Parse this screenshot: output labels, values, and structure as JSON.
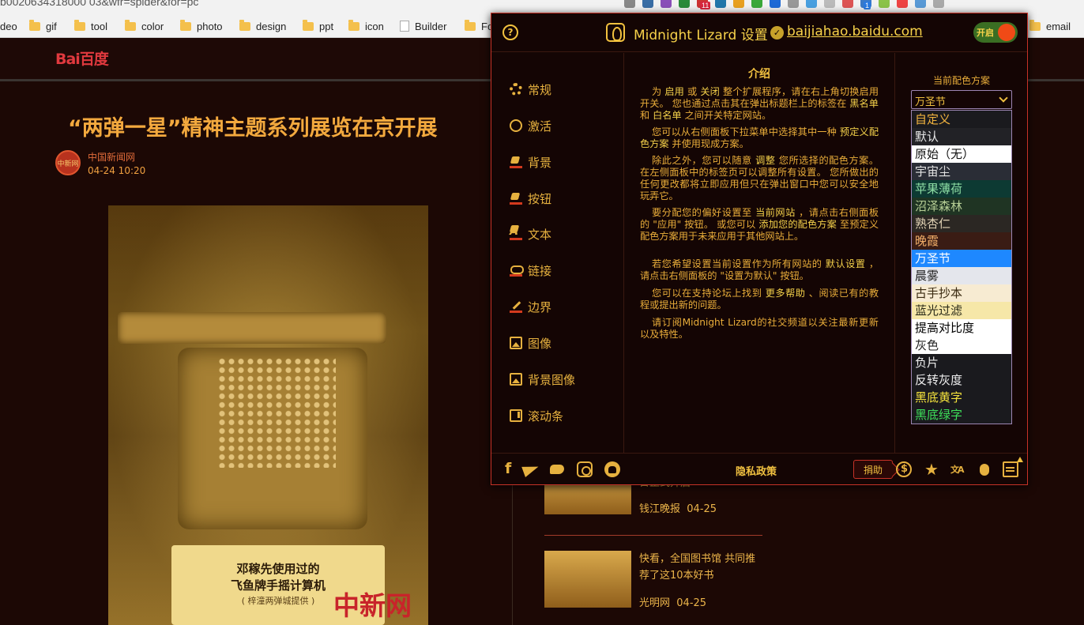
{
  "browser": {
    "url_fragment": "b0020634318000 03&wfr=spider&for=pc",
    "bookmarks": [
      "deo",
      "gif",
      "tool",
      "color",
      "photo",
      "design",
      "ppt",
      "icon",
      "Builder",
      "Fo",
      "email"
    ],
    "extension_badges": [
      "11",
      "1"
    ]
  },
  "page": {
    "logo_text": "Bai百度",
    "title": "“两弹一星”精神主题系列展览在京开展",
    "author_avatar": "中新网",
    "author": "中国新闻网",
    "time": "04-24   10:20",
    "placard_line1": "邓稼先使用过的",
    "placard_line2": "飞鱼牌手摇计算机",
    "placard_line3": "( 梓潼两弹城提供 )",
    "watermark": "中新网",
    "news": [
      {
        "title": "日正式开启",
        "source": "钱江晚报",
        "date": "04-25"
      },
      {
        "title": "快看，全国图书馆 共同推荐了这10本好书",
        "source": "光明网",
        "date": "04-25"
      }
    ]
  },
  "popup": {
    "header": {
      "app_name": "Midnight Lizard 设置",
      "site": "baijiahao.baidu.com",
      "toggle_label": "开启",
      "help_symbol": "?",
      "check_symbol": "✓"
    },
    "sidebar": [
      {
        "label": "常规",
        "icon": "gear-icon"
      },
      {
        "label": "激活",
        "icon": "check-circle-icon"
      },
      {
        "label": "背景",
        "icon": "paint-bucket-icon"
      },
      {
        "label": "按钮",
        "icon": "hand-pointer-icon"
      },
      {
        "label": "文本",
        "icon": "text-icon"
      },
      {
        "label": "链接",
        "icon": "link-icon"
      },
      {
        "label": "边界",
        "icon": "pencil-icon"
      },
      {
        "label": "图像",
        "icon": "image-icon"
      },
      {
        "label": "背景图像",
        "icon": "background-image-icon"
      },
      {
        "label": "滚动条",
        "icon": "scrollbar-icon"
      }
    ],
    "intro": {
      "heading": "介绍",
      "p1": "为 <b>启用</b> 或 <b>关闭</b> 整个扩展程序，请在右上角切换启用开关。 您也通过点击其在弹出标题栏上的标签在 <b>黑名单</b> 和 <b>白名单</b> 之间开关特定网站。",
      "p2": "您可以从右侧面板下拉菜单中选择其中一种 <b>预定义配色方案</b> 并使用现成方案。",
      "p3": "除此之外，您可以随意 <b>调整</b> 您所选择的配色方案。 在左侧面板中的标签页可以调整所有设置。 您所做出的任何更改都将立即应用但只在弹出窗口中您可以安全地玩弄它。",
      "p4": "要分配您的偏好设置至 <b>当前网站</b> ，请点击右侧面板的 \"应用\" 按钮。 或您可以 <b>添加您的配色方案</b> 至预定义配色方案用于未来应用于其他网站上。",
      "p5": "若您希望设置当前设置作为所有网站的 <b>默认设置</b> ，请点击右侧面板的 \"设置为默认\" 按钮。",
      "p6": "您可以在支持论坛上找到 <b>更多帮助</b> 、阅读已有的教程或提出新的问题。",
      "p7": "请订阅Midnight Lizard的社交频道以关注最新更新以及特性。"
    },
    "scheme": {
      "label": "当前配色方案",
      "selected": "万圣节",
      "options": [
        {
          "label": "自定义",
          "bg": "#1a1a1e",
          "fg": "#f0b23e"
        },
        {
          "label": "默认",
          "bg": "#222226",
          "fg": "#e8e8e8"
        },
        {
          "label": "原始（无）",
          "bg": "#ffffff",
          "fg": "#111111"
        },
        {
          "label": "宇宙尘",
          "bg": "#2a2d36",
          "fg": "#e2e2e2"
        },
        {
          "label": "苹果薄荷",
          "bg": "#0d3a33",
          "fg": "#8fe0a6"
        },
        {
          "label": "沼泽森林",
          "bg": "#1f3423",
          "fg": "#b7cf96"
        },
        {
          "label": "熟杏仁",
          "bg": "#2b2723",
          "fg": "#e0d2b4"
        },
        {
          "label": "晚霞",
          "bg": "#3a1c14",
          "fg": "#f4b06a"
        },
        {
          "label": "万圣节",
          "bg": "#1e88ff",
          "fg": "#ffffff"
        },
        {
          "label": "晨雾",
          "bg": "#e4e6ec",
          "fg": "#222222"
        },
        {
          "label": "古手抄本",
          "bg": "#f7ebd2",
          "fg": "#3a2a10"
        },
        {
          "label": "蓝光过滤",
          "bg": "#f6e7a8",
          "fg": "#2a2a18"
        },
        {
          "label": "提高对比度",
          "bg": "#ffffff",
          "fg": "#000000"
        },
        {
          "label": "灰色",
          "bg": "#ffffff",
          "fg": "#222222"
        },
        {
          "label": "负片",
          "bg": "#1a1a1e",
          "fg": "#eeeeee"
        },
        {
          "label": "反转灰度",
          "bg": "#1a1a1e",
          "fg": "#eeeeee"
        },
        {
          "label": "黑底黄字",
          "bg": "#1a1a1e",
          "fg": "#f4e23c"
        },
        {
          "label": "黑底绿字",
          "bg": "#1a1a1e",
          "fg": "#3ee05a"
        }
      ]
    },
    "footer": {
      "privacy": "隐私政策",
      "donate": "捐助"
    }
  },
  "colors": {
    "page_bg": "#1c0805",
    "accent": "#f0c040",
    "popup_border": "#c73227",
    "toggle_on": "#3a6e23"
  }
}
